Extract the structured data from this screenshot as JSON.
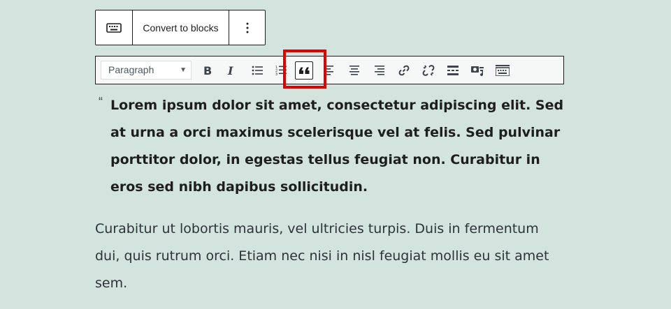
{
  "block_toolbar": {
    "keyboard_icon": "keyboard-icon",
    "convert_label": "Convert to blocks",
    "more_icon": "vertical-ellipsis-icon"
  },
  "classic_toolbar": {
    "format_select": {
      "selected": "Paragraph"
    },
    "buttons": [
      "bold",
      "italic",
      "bulleted-list",
      "numbered-list",
      "blockquote",
      "align-left",
      "align-center",
      "align-right",
      "insert-link",
      "remove-link",
      "read-more",
      "add-media",
      "toolbar-toggle"
    ],
    "active_button": "blockquote",
    "highlight_color": "#e00000"
  },
  "content": {
    "quote_mark": "“",
    "quote": "Lorem ipsum dolor sit amet, consectetur adipiscing elit. Sed at urna a orci maximus scelerisque vel at felis. Sed pulvinar porttitor dolor, in egestas tellus feugiat non. Curabitur in eros sed nibh dapibus sollicitudin.",
    "paragraph": "Curabitur ut lobortis mauris, vel ultricies turpis. Duis in fermentum dui, quis rutrum orci. Etiam nec nisi in nisl feugiat mollis eu sit amet sem."
  },
  "colors": {
    "background": "#d2e4dd",
    "text": "#1e1e1e"
  }
}
